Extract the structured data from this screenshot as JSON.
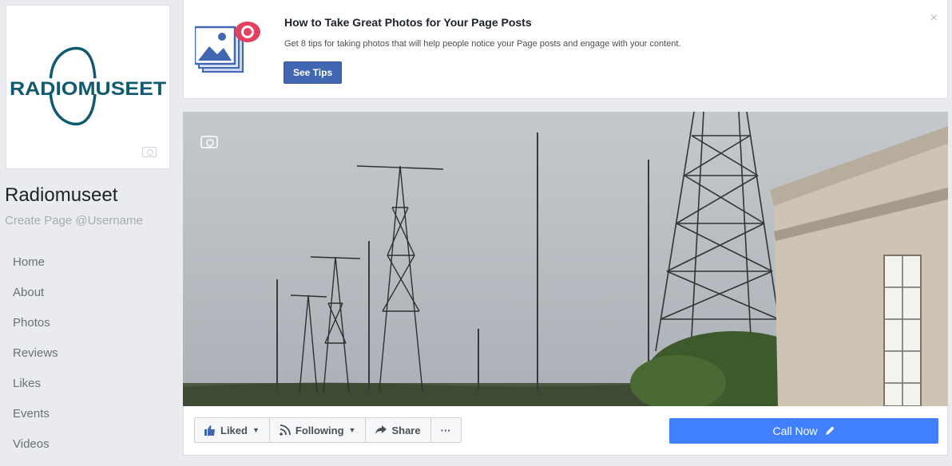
{
  "page": {
    "logo_text": "RADIOMUSEET",
    "name": "Radiomuseet",
    "username_prompt": "Create Page @Username"
  },
  "nav": {
    "items": [
      "Home",
      "About",
      "Photos",
      "Reviews",
      "Likes",
      "Events",
      "Videos"
    ]
  },
  "tip": {
    "title": "How to Take Great Photos for Your Page Posts",
    "description": "Get 8 tips for taking photos that will help people notice your Page posts and engage with your content.",
    "button_label": "See Tips",
    "close_label": "×"
  },
  "actions": {
    "liked_label": "Liked",
    "following_label": "Following",
    "share_label": "Share",
    "more_label": "···",
    "call_label": "Call Now"
  },
  "colors": {
    "brand_blue": "#4267b2",
    "call_blue": "#4080ff",
    "logo_teal": "#0f5a6e"
  }
}
